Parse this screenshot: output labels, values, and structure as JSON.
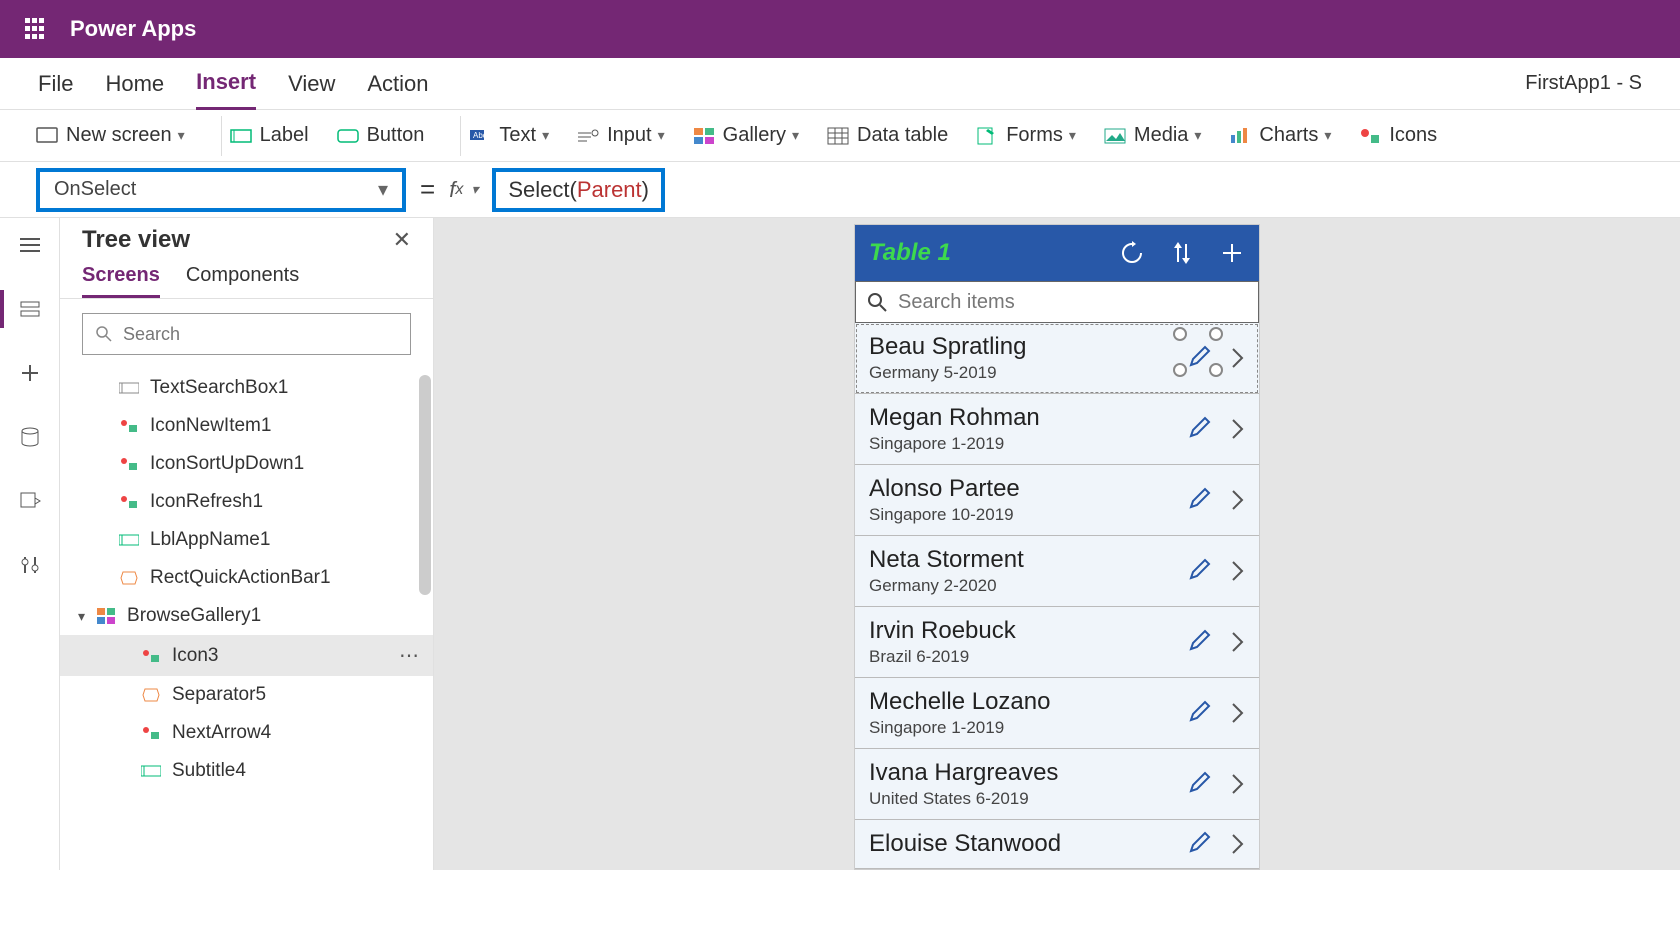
{
  "header": {
    "app_title": "Power Apps"
  },
  "app_name": "FirstApp1 - S",
  "menu": {
    "file": "File",
    "home": "Home",
    "insert": "Insert",
    "view": "View",
    "action": "Action"
  },
  "toolbar": {
    "new_screen": "New screen",
    "label": "Label",
    "button": "Button",
    "text": "Text",
    "input": "Input",
    "gallery": "Gallery",
    "data_table": "Data table",
    "forms": "Forms",
    "media": "Media",
    "charts": "Charts",
    "icons": "Icons"
  },
  "formula": {
    "property": "OnSelect",
    "func": "Select",
    "ref": "Parent"
  },
  "tree": {
    "title": "Tree view",
    "tabs": {
      "screens": "Screens",
      "components": "Components"
    },
    "search_placeholder": "Search",
    "items": [
      {
        "label": "TextSearchBox1",
        "icon": "text-input-icon"
      },
      {
        "label": "IconNewItem1",
        "icon": "group-icon"
      },
      {
        "label": "IconSortUpDown1",
        "icon": "group-icon"
      },
      {
        "label": "IconRefresh1",
        "icon": "group-icon"
      },
      {
        "label": "LblAppName1",
        "icon": "label-icon"
      },
      {
        "label": "RectQuickActionBar1",
        "icon": "shape-icon"
      },
      {
        "label": "BrowseGallery1",
        "icon": "gallery-icon",
        "expanded": true
      },
      {
        "label": "Icon3",
        "icon": "group-icon",
        "selected": true
      },
      {
        "label": "Separator5",
        "icon": "shape-icon"
      },
      {
        "label": "NextArrow4",
        "icon": "group-icon"
      },
      {
        "label": "Subtitle4",
        "icon": "label-icon"
      }
    ]
  },
  "phone": {
    "title": "Table 1",
    "search_placeholder": "Search items",
    "items": [
      {
        "name": "Beau Spratling",
        "sub": "Germany 5-2019",
        "selected": true
      },
      {
        "name": "Megan Rohman",
        "sub": "Singapore 1-2019"
      },
      {
        "name": "Alonso Partee",
        "sub": "Singapore 10-2019"
      },
      {
        "name": "Neta Storment",
        "sub": "Germany 2-2020"
      },
      {
        "name": "Irvin Roebuck",
        "sub": "Brazil 6-2019"
      },
      {
        "name": "Mechelle Lozano",
        "sub": "Singapore 1-2019"
      },
      {
        "name": "Ivana Hargreaves",
        "sub": "United States 6-2019"
      },
      {
        "name": "Elouise Stanwood",
        "sub": ""
      }
    ]
  }
}
